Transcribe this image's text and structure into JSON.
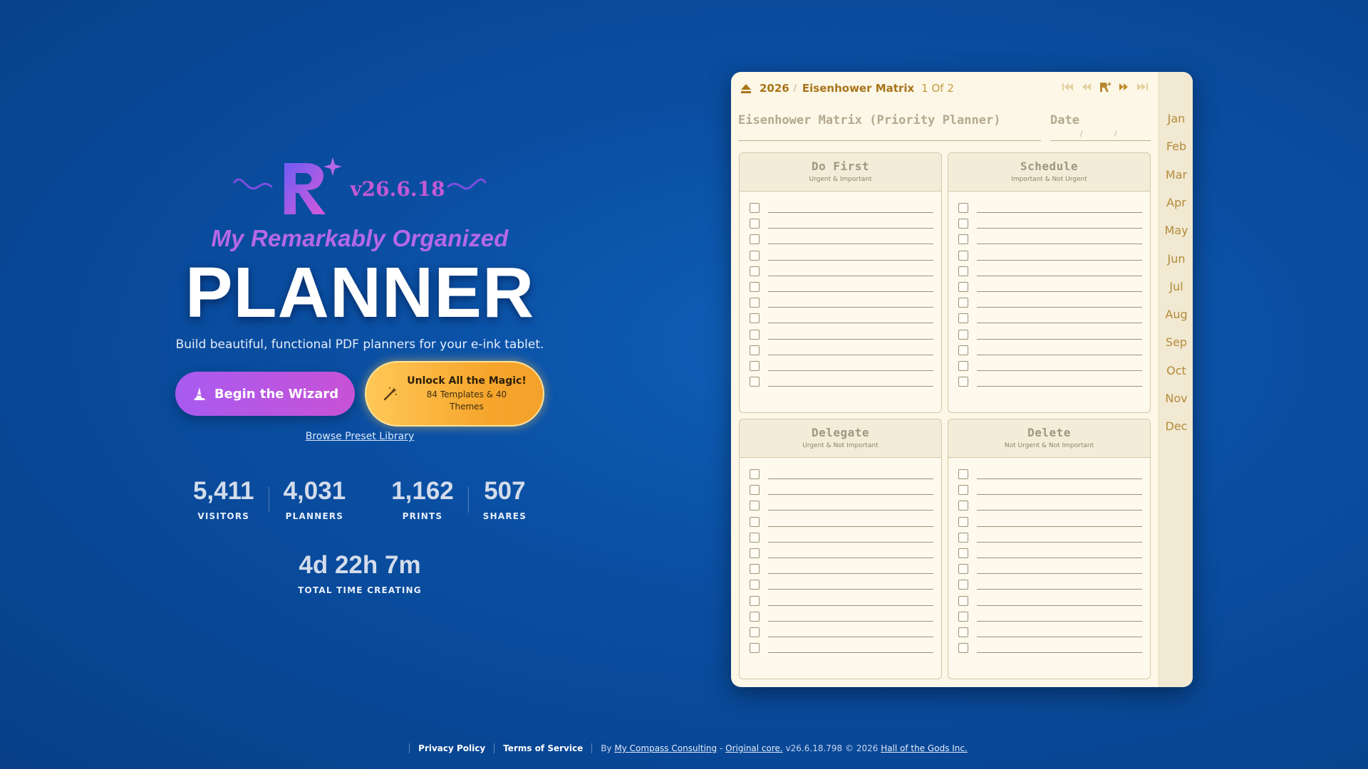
{
  "hero": {
    "version": "v26.6.18",
    "tagline": "My Remarkably Organized",
    "title": "PLANNER",
    "subtitle": "Build beautiful, functional PDF planners for your e-ink tablet.",
    "wizard_label": "Begin the Wizard",
    "magic_title": "Unlock All the Magic!",
    "magic_sub": "84 Templates & 40 Themes",
    "browse_label": "Browse Preset Library"
  },
  "stats": [
    {
      "value": "5,411",
      "label": "VISITORS"
    },
    {
      "value": "4,031",
      "label": "PLANNERS"
    },
    {
      "value": "1,162",
      "label": "PRINTS"
    },
    {
      "value": "507",
      "label": "SHARES"
    }
  ],
  "time": {
    "value": "4d 22h 7m",
    "label": "TOTAL TIME CREATING"
  },
  "planner": {
    "crumb_year": "2026",
    "crumb_sep": "/",
    "crumb_page": "Eisenhower Matrix",
    "page_indicator": "1 Of 2",
    "page_title": "Eisenhower Matrix (Priority Planner)",
    "date_label": "Date",
    "date_slash": "/",
    "quadrants": [
      {
        "title": "Do First",
        "subtitle": "Urgent & Important"
      },
      {
        "title": "Schedule",
        "subtitle": "Important & Not Urgent"
      },
      {
        "title": "Delegate",
        "subtitle": "Urgent & Not Important"
      },
      {
        "title": "Delete",
        "subtitle": "Not Urgent & Not Important"
      }
    ],
    "tasks_per_quadrant": 12,
    "months": [
      "Jan",
      "Feb",
      "Mar",
      "Apr",
      "May",
      "Jun",
      "Jul",
      "Aug",
      "Sep",
      "Oct",
      "Nov",
      "Dec"
    ]
  },
  "footer": {
    "privacy": "Privacy Policy",
    "terms": "Terms of Service",
    "by": "By",
    "company": "My Compass Consulting",
    "dash": "-",
    "core": "Original core.",
    "build": "v26.6.18.798 © 2026",
    "owner": "Hall of the Gods Inc."
  },
  "colors": {
    "background": "#0a4fa3",
    "accent_purple": "#b568e6",
    "accent_orange": "#f6a52b",
    "planner_paper": "#fcf7e6",
    "planner_gold": "#a9741b"
  }
}
